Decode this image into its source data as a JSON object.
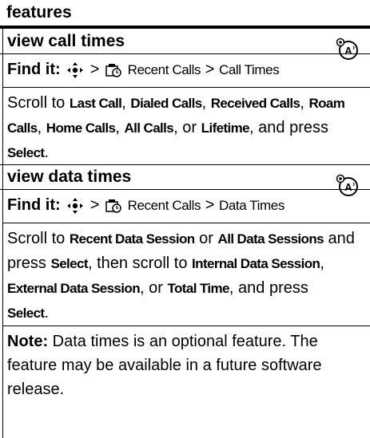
{
  "header": {
    "title": "features"
  },
  "section1": {
    "title": "view call times",
    "find_label": "Find it:",
    "path_sep1": ">",
    "path_recent": "Recent Calls",
    "path_sep2": ">",
    "path_target": "Call Times",
    "body": {
      "scroll_to": "Scroll to",
      "last_call": "Last Call",
      "dialed": "Dialed Calls",
      "received": "Received Calls",
      "roam": "Roam Calls",
      "home": "Home Calls",
      "all": "All Calls",
      "or": "or",
      "lifetime": "Lifetime",
      "and_press": "and press",
      "select": "Select"
    }
  },
  "section2": {
    "title": "view data times",
    "find_label": "Find it:",
    "path_sep1": ">",
    "path_recent": "Recent Calls",
    "path_sep2": ">",
    "path_target": "Data Times",
    "body": {
      "scroll_to": "Scroll to",
      "recent_session": "Recent Data Session",
      "or": "or",
      "all_sessions": "All Data Sessions",
      "and_press": "and",
      "press": "press",
      "select": "Select",
      "then_scroll": "then scroll to",
      "internal": "Internal Data Session",
      "external": "External Data Session",
      "total": "Total Time",
      "and_press2": "and press"
    },
    "note_label": "Note:",
    "note_text": "Data times is an optional feature. The feature may be available in a future software release."
  },
  "icons": {
    "network_feature": "network-feature-icon",
    "nav_key": "nav-key-icon",
    "recent_calls": "recent-calls-menu-icon"
  }
}
